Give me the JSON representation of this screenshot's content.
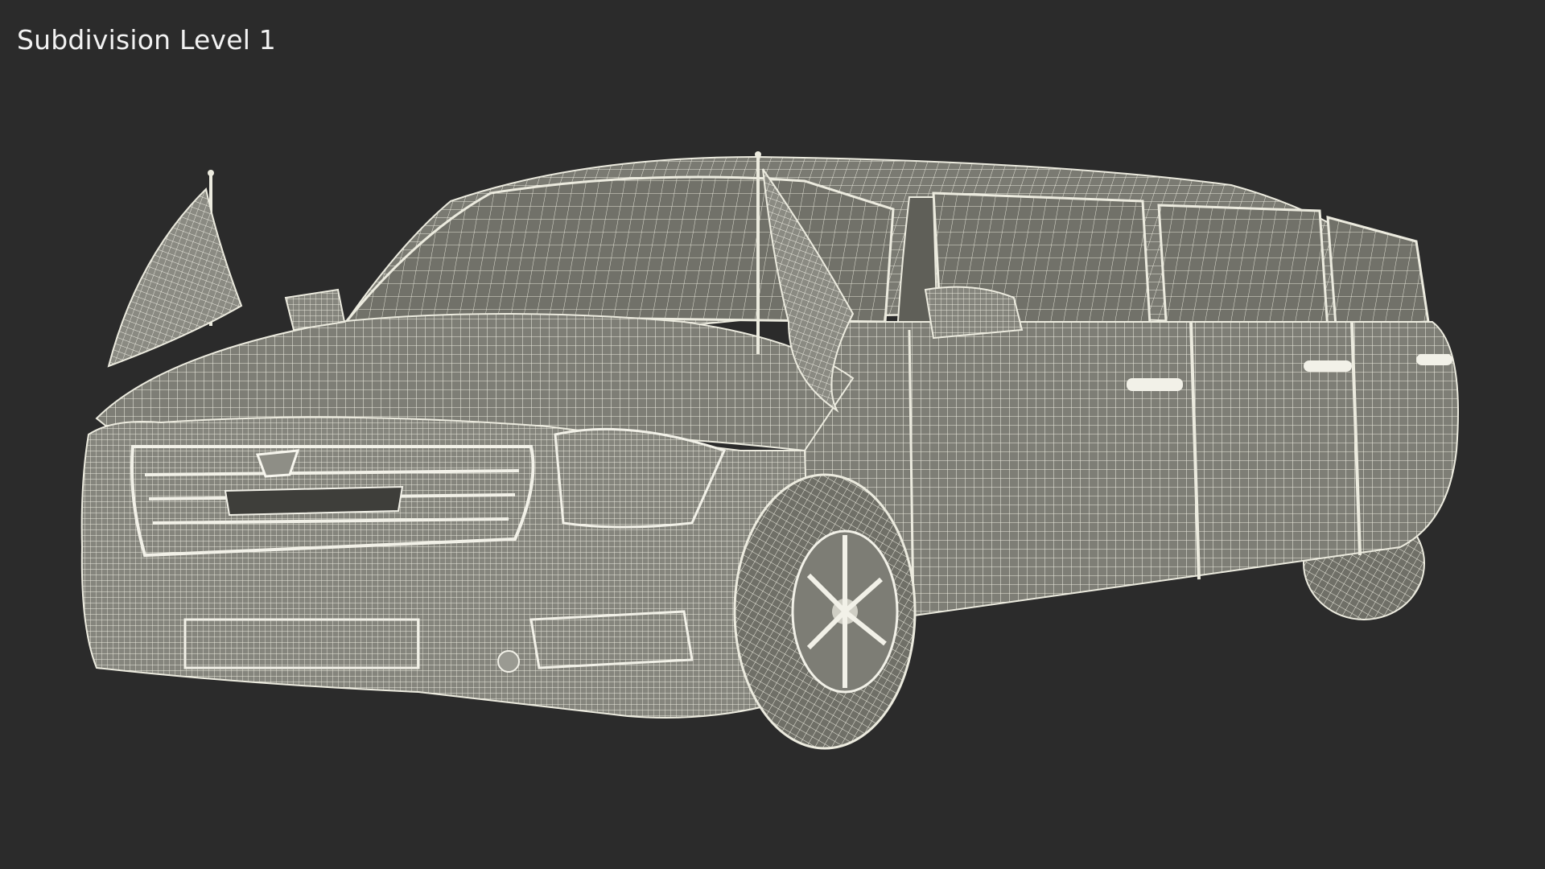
{
  "viewport": {
    "label": "Subdivision Level 1",
    "background_color": "#2b2b2b",
    "wire_color": "#ecebdf",
    "surface_color": "#7e7e76",
    "subject": "wireframe-limousine-with-flags"
  }
}
